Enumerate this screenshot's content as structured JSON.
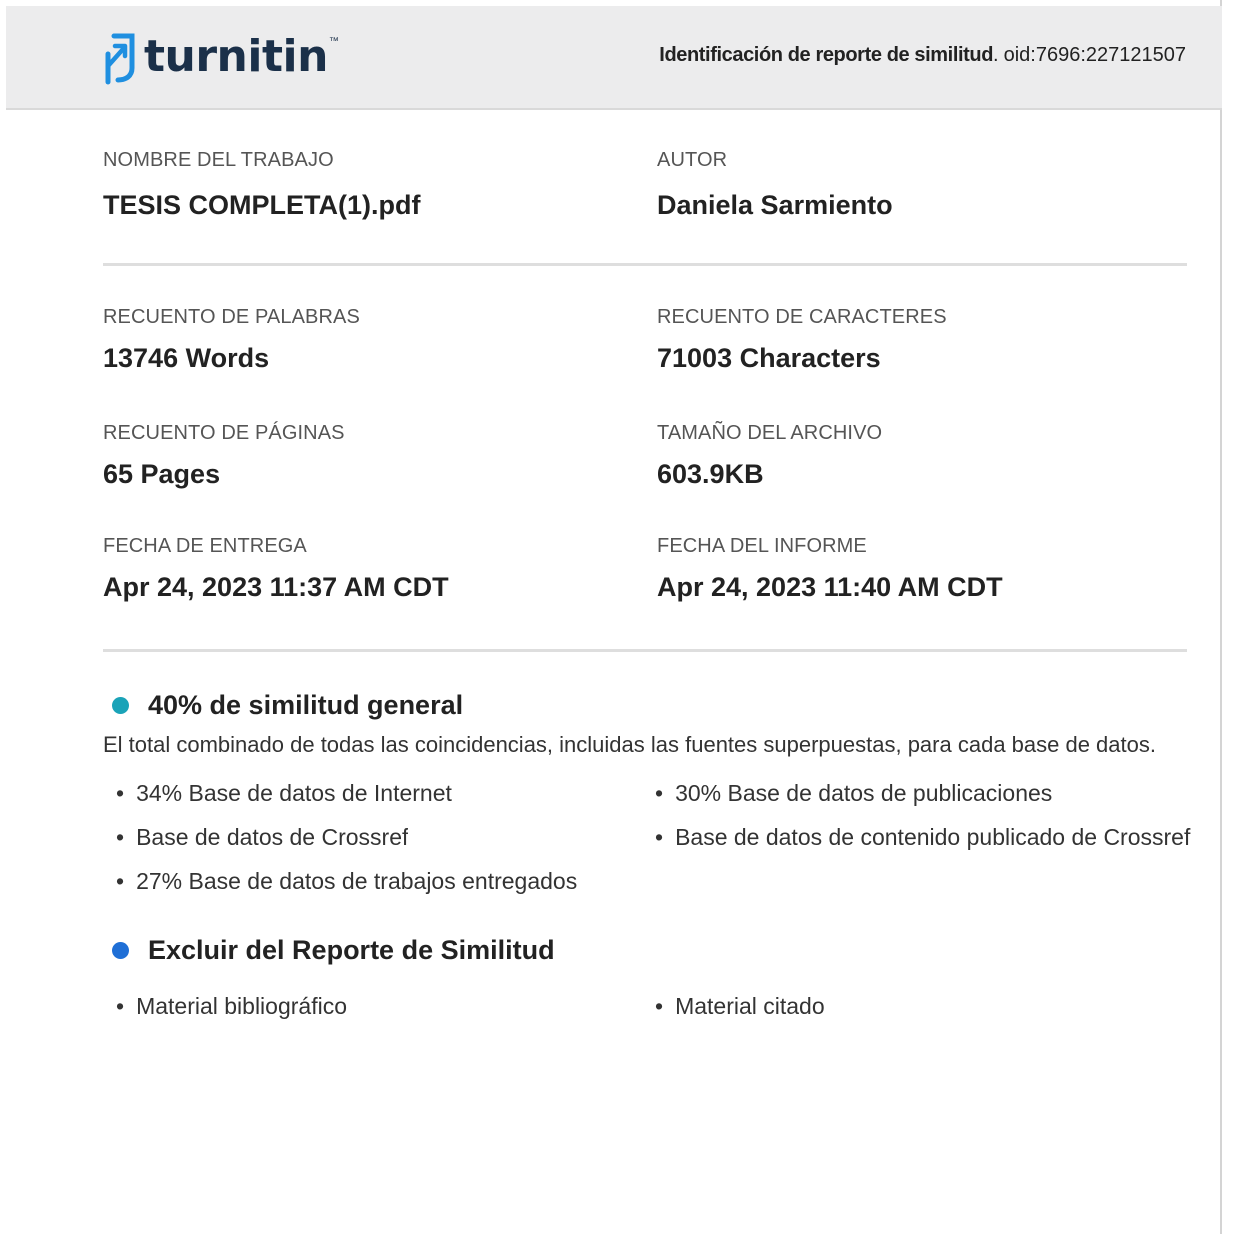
{
  "header": {
    "brand": "turnitin",
    "brand_tm": "™",
    "report_id_label": "Identificación de reporte de similitud",
    "report_id_value": "oid:7696:227121507"
  },
  "info": {
    "job_name_label": "NOMBRE  DEL TRABAJO",
    "job_name_value": "TESIS COMPLETA(1).pdf",
    "author_label": "AUTOR",
    "author_value": "Daniela Sarmiento",
    "word_count_label": "RECUENTO DE PALABRAS",
    "word_count_value": "13746 Words",
    "char_count_label": "RECUENTO  DE CARACTERES",
    "char_count_value": "71003 Characters",
    "page_count_label": "RECUENTO  DE PÁGINAS",
    "page_count_value": "65 Pages",
    "file_size_label": "TAMAÑO DEL ARCHIVO",
    "file_size_value": "603.9KB",
    "submit_date_label": "FECHA DE ENTREGA",
    "submit_date_value": "Apr 24, 2023 11:37 AM CDT",
    "report_date_label": "FECHA DEL INFORME",
    "report_date_value": "Apr 24, 2023 11:40 AM CDT"
  },
  "similarity": {
    "title": "40% de similitud general",
    "description": "El total combinado de todas las coincidencias, incluidas las fuentes superpuestas, para cada base de datos.",
    "bullet_color": "#1aa3b8",
    "items_left": [
      "34% Base de datos de Internet",
      "Base de datos de Crossref",
      "27% Base de datos de trabajos entregados"
    ],
    "items_right": [
      "30% Base de datos de publicaciones",
      "Base de datos de contenido publicado de Crossref"
    ]
  },
  "exclude": {
    "title": "Excluir  del Reporte de Similitud",
    "bullet_color": "#1f6fd6",
    "items_left": [
      "Material bibliográfico"
    ],
    "items_right": [
      "Material citado"
    ]
  }
}
